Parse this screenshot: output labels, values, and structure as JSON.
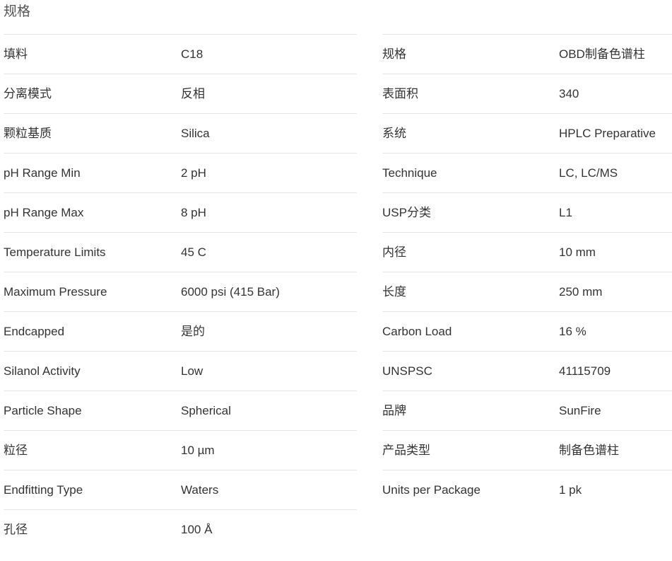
{
  "section": {
    "title": "规格"
  },
  "left_specs": [
    {
      "label": "填料",
      "value": "C18"
    },
    {
      "label": "分离模式",
      "value": "反相"
    },
    {
      "label": "颗粒基质",
      "value": "Silica"
    },
    {
      "label": "pH Range Min",
      "value": "2 pH"
    },
    {
      "label": "pH Range Max",
      "value": "8 pH"
    },
    {
      "label": "Temperature Limits",
      "value": "45 C"
    },
    {
      "label": "Maximum Pressure",
      "value": "6000 psi (415 Bar)"
    },
    {
      "label": "Endcapped",
      "value": "是的"
    },
    {
      "label": "Silanol Activity",
      "value": "Low"
    },
    {
      "label": "Particle Shape",
      "value": "Spherical"
    },
    {
      "label": "粒径",
      "value": "10 µm"
    },
    {
      "label": "Endfitting Type",
      "value": "Waters"
    },
    {
      "label": "孔径",
      "value": "100 Å"
    }
  ],
  "right_specs": [
    {
      "label": "规格",
      "value": "OBD制备色谱柱"
    },
    {
      "label": "表面积",
      "value": "340"
    },
    {
      "label": "系统",
      "value": "HPLC Preparative"
    },
    {
      "label": "Technique",
      "value": "LC, LC/MS"
    },
    {
      "label": "USP分类",
      "value": "L1"
    },
    {
      "label": "内径",
      "value": "10 mm"
    },
    {
      "label": "长度",
      "value": "250 mm"
    },
    {
      "label": "Carbon Load",
      "value": "16 %"
    },
    {
      "label": "UNSPSC",
      "value": "41115709"
    },
    {
      "label": "品牌",
      "value": "SunFire"
    },
    {
      "label": "产品类型",
      "value": "制备色谱柱"
    },
    {
      "label": "Units per Package",
      "value": "1 pk"
    }
  ],
  "colors": {
    "text": "#333333",
    "title": "#555555",
    "divider": "#e5e5e5",
    "background": "#ffffff"
  }
}
